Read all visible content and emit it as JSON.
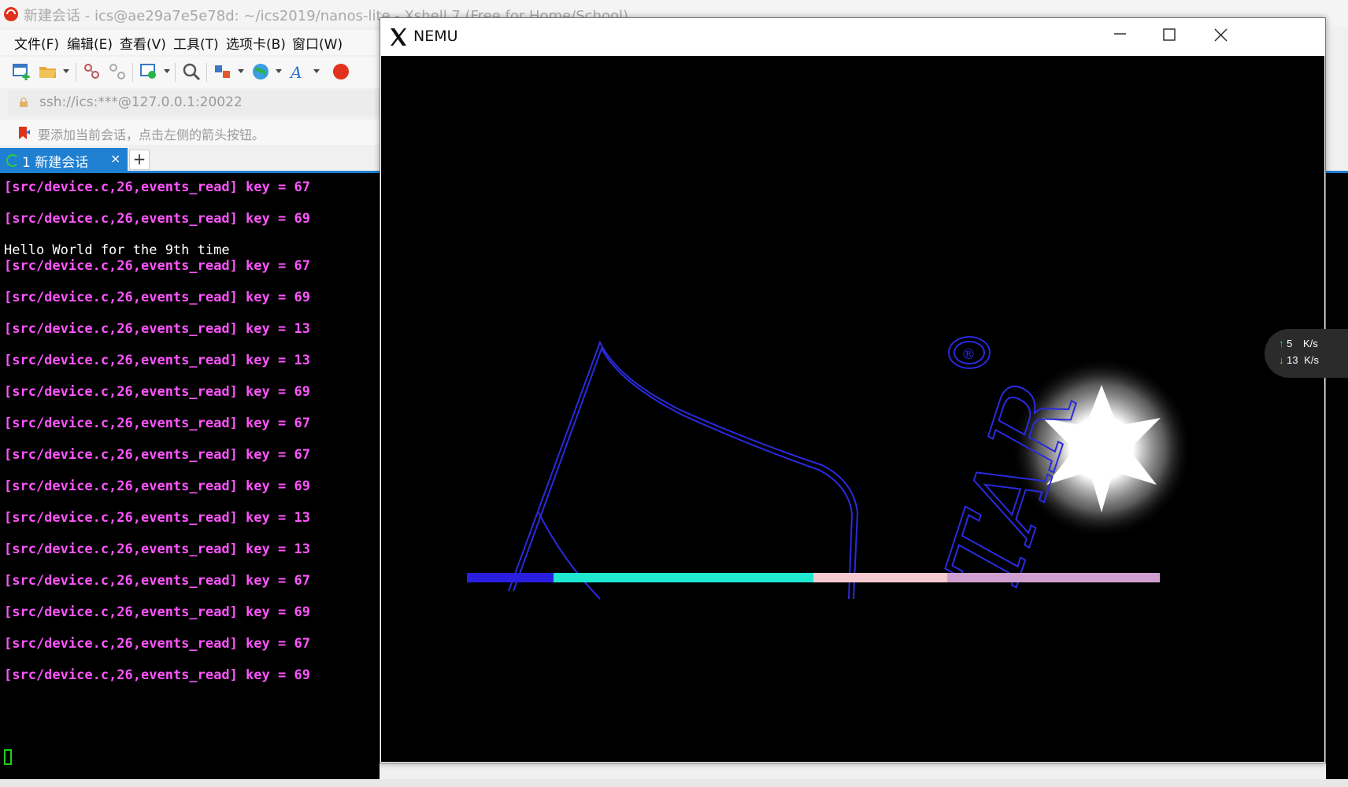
{
  "xshell": {
    "title": "新建会话 - ics@ae29a7e5e78d: ~/ics2019/nanos-lite - Xshell 7 (Free for Home/School)",
    "menu": [
      "文件(F)",
      "编辑(E)",
      "查看(V)",
      "工具(T)",
      "选项卡(B)",
      "窗口(W)"
    ],
    "address": "ssh://ics:***@127.0.0.1:20022",
    "hint": "要添加当前会话，点击左侧的箭头按钮。",
    "tab": {
      "label": "1 新建会话",
      "close": "×",
      "new": "+"
    }
  },
  "terminal": {
    "lines": [
      {
        "text": "[src/device.c,26,events_read] key = 67"
      },
      {
        "text": "[src/device.c,26,events_read] key = 69"
      },
      {
        "text": "Hello World for the 9th time"
      },
      {
        "text": "[src/device.c,26,events_read] key = 67"
      },
      {
        "text": "[src/device.c,26,events_read] key = 69"
      },
      {
        "text": "[src/device.c,26,events_read] key = 13"
      },
      {
        "text": "[src/device.c,26,events_read] key = 13"
      },
      {
        "text": "[src/device.c,26,events_read] key = 69"
      },
      {
        "text": "[src/device.c,26,events_read] key = 67"
      },
      {
        "text": "[src/device.c,26,events_read] key = 67"
      },
      {
        "text": "[src/device.c,26,events_read] key = 69"
      },
      {
        "text": "[src/device.c,26,events_read] key = 13"
      },
      {
        "text": "[src/device.c,26,events_read] key = 13"
      },
      {
        "text": "[src/device.c,26,events_read] key = 67"
      },
      {
        "text": "[src/device.c,26,events_read] key = 69"
      },
      {
        "text": "[src/device.c,26,events_read] key = 67"
      },
      {
        "text": "[src/device.c,26,events_read] key = 69"
      }
    ],
    "colors": {
      "log": "#ff55ff",
      "plain": "#ffffff",
      "cursor": "#22cc22"
    }
  },
  "nemu": {
    "title": "NEMU",
    "logo_text": "TAR",
    "progress_colors": [
      "#2a1fe0",
      "#1fe8d0",
      "#f4cad0",
      "#cfa0cf"
    ]
  },
  "network": {
    "up": "5",
    "down": "13",
    "unit": "K/s"
  }
}
